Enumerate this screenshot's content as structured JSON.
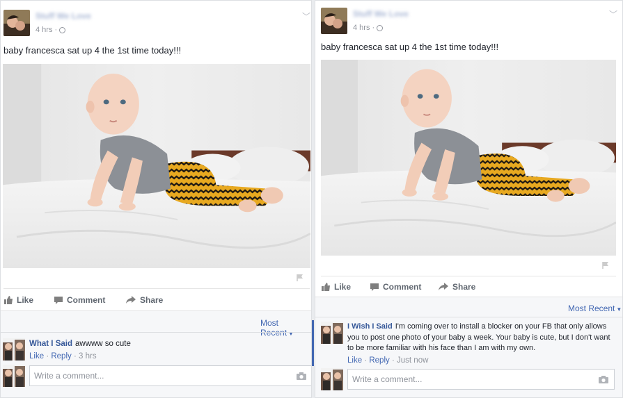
{
  "posts": [
    {
      "page_name": "Stuff We Love",
      "time": "4 hrs",
      "text": "baby francesca sat up 4 the 1st time today!!!",
      "actions": {
        "like": "Like",
        "comment": "Comment",
        "share": "Share"
      },
      "sort_label": "Most Recent",
      "comment": {
        "author": "What I Said",
        "text": "awwww so cute",
        "like": "Like",
        "reply": "Reply",
        "time": "3 hrs"
      },
      "write_placeholder": "Write a comment..."
    },
    {
      "page_name": "Stuff We Love",
      "time": "4 hrs",
      "text": "baby francesca sat up 4 the 1st time today!!!",
      "actions": {
        "like": "Like",
        "comment": "Comment",
        "share": "Share"
      },
      "sort_label": "Most Recent",
      "comment": {
        "author": "I Wish I Said",
        "text": "I'm coming over to install a blocker on your FB that only allows you to post one photo of your baby a week. Your baby is cute, but I don't want to be more familiar with his face than I am with my own.",
        "like": "Like",
        "reply": "Reply",
        "time": "Just now"
      },
      "write_placeholder": "Write a comment..."
    }
  ],
  "icons": [
    "avatar",
    "globe-icon",
    "chevron-down-icon",
    "flag-icon",
    "like-icon",
    "comment-icon",
    "share-icon",
    "camera-icon"
  ],
  "colors": {
    "link": "#365899",
    "accent": "#4267b2",
    "meta": "#90949c",
    "action": "#606770"
  }
}
